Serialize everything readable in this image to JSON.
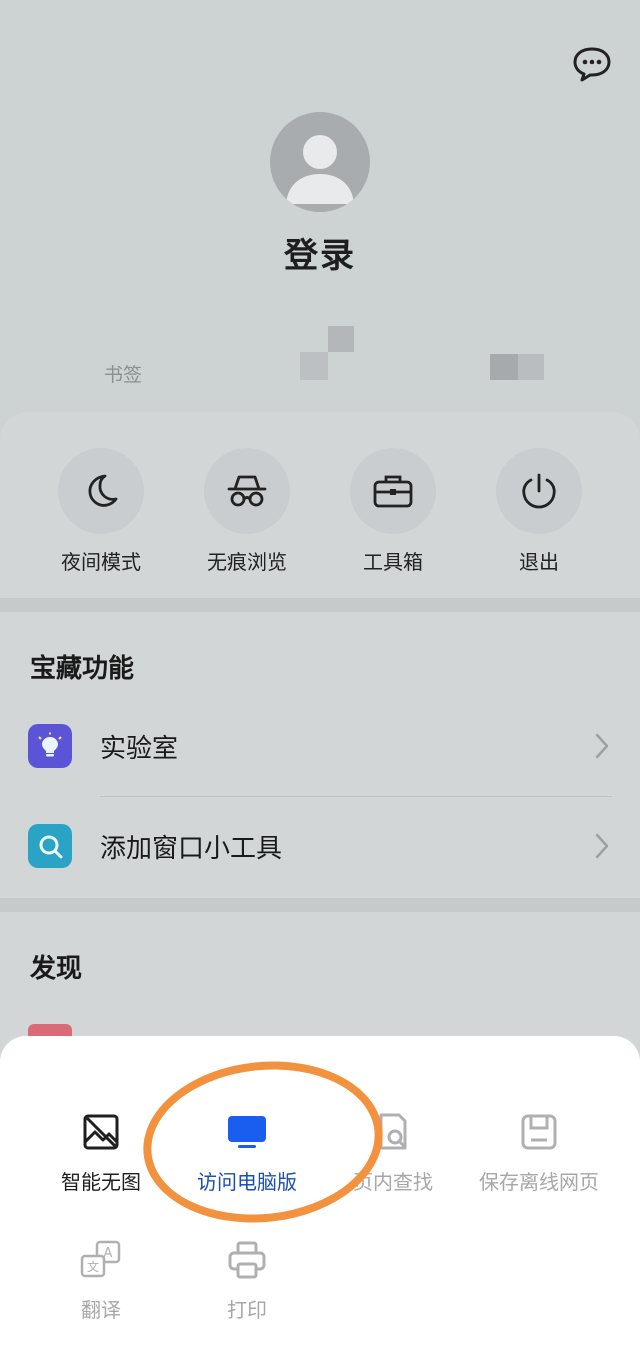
{
  "header": {
    "login_label": "登录",
    "stats": {
      "bookmark_label": "书签"
    }
  },
  "quick_actions": [
    {
      "label": "夜间模式",
      "icon": "moon-icon"
    },
    {
      "label": "无痕浏览",
      "icon": "incognito-icon"
    },
    {
      "label": "工具箱",
      "icon": "toolbox-icon"
    },
    {
      "label": "退出",
      "icon": "power-icon"
    }
  ],
  "treasure": {
    "title": "宝藏功能",
    "items": [
      {
        "label": "实验室",
        "icon": "lightbulb-icon",
        "color": "#5b54d6"
      },
      {
        "label": "添加窗口小工具",
        "icon": "widget-search-icon",
        "color": "#2aa3c4"
      }
    ]
  },
  "discover": {
    "title": "发现"
  },
  "tools": [
    {
      "label": "智能无图",
      "icon": "no-image-icon",
      "state": "normal"
    },
    {
      "label": "访问电脑版",
      "icon": "desktop-monitor-icon",
      "state": "active",
      "color": "#1a5ef0"
    },
    {
      "label": "页内查找",
      "icon": "find-in-page-icon",
      "state": "dim"
    },
    {
      "label": "保存离线网页",
      "icon": "save-offline-icon",
      "state": "dim"
    },
    {
      "label": "翻译",
      "icon": "translate-icon",
      "state": "dim"
    },
    {
      "label": "打印",
      "icon": "printer-icon",
      "state": "dim"
    }
  ],
  "colors": {
    "highlight_ring": "#f2913e",
    "active_label": "#1b4fae"
  }
}
